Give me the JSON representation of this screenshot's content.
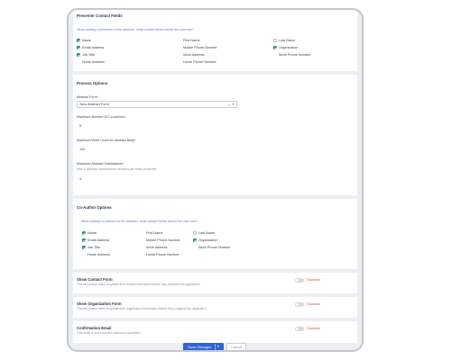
{
  "presenter": {
    "title": "Presenter Contact Fields",
    "hint": "When adding a presenter to the abstract, what contact fields should the user see?",
    "fields": [
      {
        "label": "Name",
        "checked": true
      },
      {
        "label": "First Name",
        "checked": false
      },
      {
        "label": "Last Name",
        "checked": false
      },
      {
        "label": "Email Address",
        "checked": true
      },
      {
        "label": "Mobile Phone Number",
        "checked": false
      },
      {
        "label": "Organization",
        "checked": true
      },
      {
        "label": "Job Title",
        "checked": true
      },
      {
        "label": "Work Address",
        "checked": false
      },
      {
        "label": "Work Phone Number",
        "checked": false
      },
      {
        "label": "Home Address",
        "checked": false
      },
      {
        "label": "Home Phone Number",
        "checked": false
      }
    ]
  },
  "process": {
    "title": "Process Options",
    "abstract_form_label": "Abstract Form",
    "abstract_form_value": "New Abstract Form",
    "clear_symbol": "×",
    "chevron_symbol": "▾",
    "max_coauthors_label": "Maximum Number Of Co-authors",
    "max_coauthors_value": "5",
    "max_word_label": "Maximum Word Count for Abstract Body",
    "max_word_value": "100",
    "max_submissions_label": "Maximum Abstract Submissions",
    "max_submissions_hint": "Max # abstract submissions allowed per main presenter",
    "max_submissions_value": "3",
    "required_mark": "*"
  },
  "coauthor": {
    "title": "Co-Author Options",
    "hint": "When adding co-authors to the abstract, what contact fields should the user see?",
    "fields": [
      {
        "label": "Name",
        "checked": true
      },
      {
        "label": "First Name",
        "checked": false
      },
      {
        "label": "Last Name",
        "checked": false
      },
      {
        "label": "Email Address",
        "checked": true
      },
      {
        "label": "Mobile Phone Number",
        "checked": false
      },
      {
        "label": "Organization",
        "checked": true
      },
      {
        "label": "Job Title",
        "checked": true
      },
      {
        "label": "Work Address",
        "checked": false
      },
      {
        "label": "Work Phone Number",
        "checked": false
      },
      {
        "label": "Home Address",
        "checked": false
      },
      {
        "label": "Home Phone Number",
        "checked": false
      }
    ]
  },
  "toggles": [
    {
      "title": "Show Contact Form",
      "subtitle": "This will prompt users to update their contact information before they complete the application.",
      "state": "Disabled",
      "on": false
    },
    {
      "title": "Show Organization Form",
      "subtitle": "This will prompt users to update their organization information before they complete the application.",
      "state": "Disabled",
      "on": false
    },
    {
      "title": "Confirmation Email",
      "subtitle": "This email is sent once the abstract is submitted.",
      "state": "Disabled",
      "on": false
    }
  ],
  "footer": {
    "save_label": "Save Changes",
    "save_caret": "▾",
    "cancel_label": "Cancel"
  },
  "colors": {
    "accent": "#2f63d6",
    "checkbox_checked": "#2f8f7f",
    "disabled_text": "#e05252",
    "hint_text": "#6a7bd6"
  }
}
